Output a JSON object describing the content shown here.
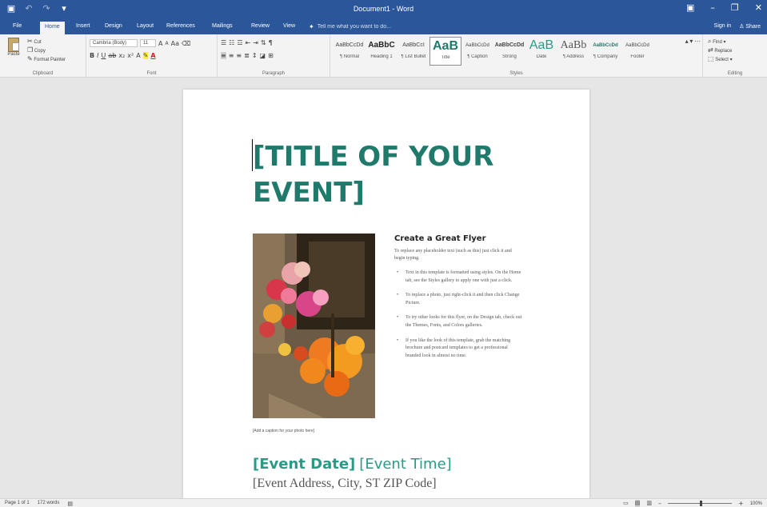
{
  "titlebar": {
    "title": "Document1 - Word",
    "qat": [
      "save-icon",
      "undo-icon",
      "redo-icon",
      "customize-icon"
    ],
    "window_controls": [
      "ribbon-display-icon",
      "minimize-icon",
      "restore-icon",
      "close-icon"
    ]
  },
  "tabs": {
    "items": [
      "File",
      "Home",
      "Insert",
      "Design",
      "Layout",
      "References",
      "Mailings",
      "Review",
      "View"
    ],
    "active": "Home",
    "tell_me": "Tell me what you want to do...",
    "sign_in": "Sign in",
    "share": "Share"
  },
  "ribbon": {
    "clipboard": {
      "label": "Clipboard",
      "paste": "Paste",
      "cut": "Cut",
      "copy": "Copy",
      "format_painter": "Format Painter"
    },
    "font": {
      "label": "Font",
      "font_name": "Cambria (Body)",
      "font_size": "11"
    },
    "paragraph": {
      "label": "Paragraph"
    },
    "styles": {
      "label": "Styles",
      "items": [
        {
          "preview": "AaBbCcDd",
          "name": "¶ Normal"
        },
        {
          "preview": "AaBbC",
          "name": "Heading 1"
        },
        {
          "preview": "AaBbCcI",
          "name": "¶ List Bullet"
        },
        {
          "preview": "AaB",
          "name": "Title"
        },
        {
          "preview": "AaBbCcDd",
          "name": "¶ Caption"
        },
        {
          "preview": "AaBbCcDd",
          "name": "Strong"
        },
        {
          "preview": "AaB",
          "name": "Date"
        },
        {
          "preview": "AaBb",
          "name": "¶ Address"
        },
        {
          "preview": "AaBbCcDd",
          "name": "¶ Company"
        },
        {
          "preview": "AaBbCcDd",
          "name": "Footer"
        }
      ]
    },
    "editing": {
      "label": "Editing",
      "find": "Find",
      "replace": "Replace",
      "select": "Select"
    }
  },
  "document": {
    "title": "[TITLE OF YOUR EVENT]",
    "caption": "[Add a caption for your photo here]",
    "side_heading": "Create a Great Flyer",
    "side_intro": "To replace any placeholder text (such as this) just click it and begin typing.",
    "bullets": [
      "Text in this template is formatted using styles. On the Home tab, see the Styles gallery to apply one with just a click.",
      "To replace a photo, just right-click it and then click Change Picture.",
      "To try other looks for this flyer, on the Design tab, check out the Themes, Fonts, and Colors galleries.",
      "If you like the look of this template, grab the matching brochure and postcard templates to get a professional branded look in almost no time."
    ],
    "event_date": "[Event Date]",
    "event_time": "[Event Time]",
    "event_address": "[Event Address, City, ST  ZIP Code]"
  },
  "status": {
    "page": "Page 1 of 1",
    "words": "172 words",
    "zoom": "100%"
  },
  "colors": {
    "brand": "#2b579a",
    "accent": "#1f7a6b"
  }
}
